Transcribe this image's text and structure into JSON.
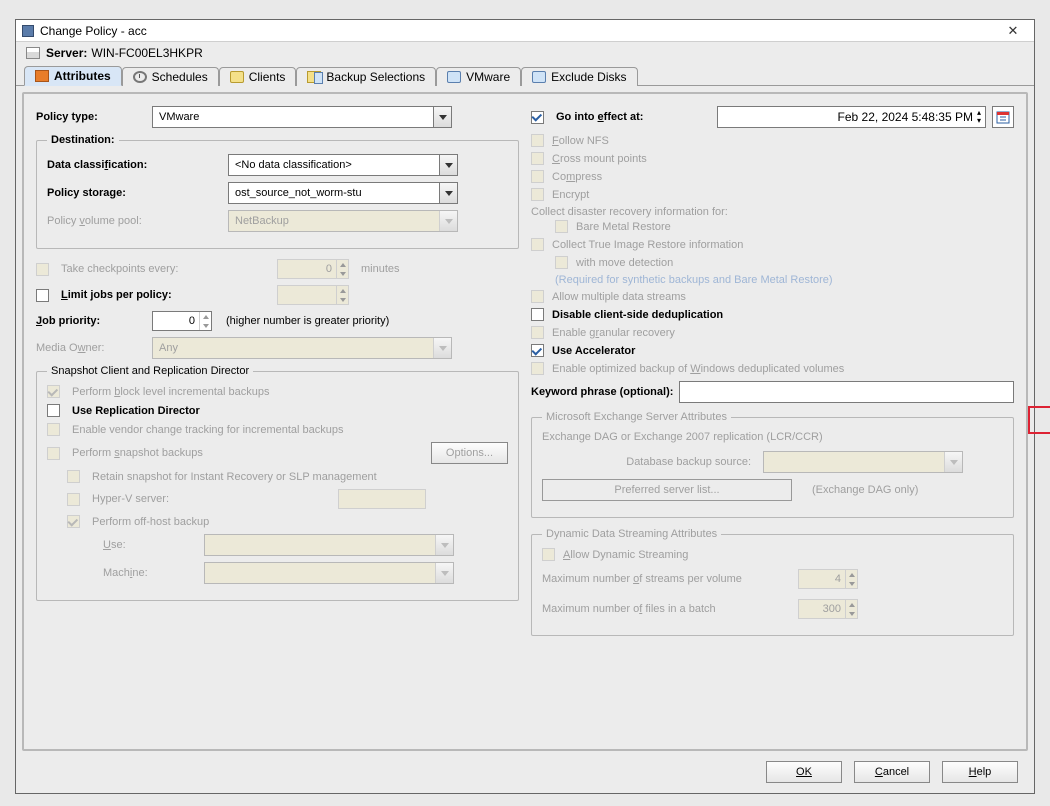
{
  "window": {
    "title": "Change Policy - acc"
  },
  "server": {
    "label": "Server:",
    "name": "WIN-FC00EL3HKPR"
  },
  "tabs": {
    "attributes": "Attributes",
    "schedules": "Schedules",
    "clients": "Clients",
    "backup_selections": "Backup Selections",
    "vmware": "VMware",
    "exclude_disks": "Exclude Disks"
  },
  "left": {
    "policy_type_label": "Policy type:",
    "policy_type_value": "VMware",
    "destination_legend": "Destination:",
    "data_classification_label": "Data classification:",
    "data_classification_value": "<No data classification>",
    "policy_storage_label": "Policy storage:",
    "policy_storage_value": "ost_source_not_worm-stu",
    "policy_volume_pool_label": "Policy volume pool:",
    "policy_volume_pool_value": "NetBackup",
    "take_checkpoints_label": "Take checkpoints every:",
    "take_checkpoints_value": "0",
    "take_checkpoints_unit": "minutes",
    "limit_jobs_label": "Limit jobs per policy:",
    "limit_jobs_value": "",
    "job_priority_label": "Job priority:",
    "job_priority_value": "0",
    "job_priority_hint": "(higher number is greater priority)",
    "media_owner_label": "Media Owner:",
    "media_owner_value": "Any",
    "snapshot_legend": "Snapshot Client and Replication Director",
    "block_level": "Perform block level incremental backups",
    "use_repl_director": "Use Replication Director",
    "vendor_change": "Enable vendor change tracking for incremental backups",
    "perform_snapshot": "Perform snapshot backups",
    "options_btn": "Options...",
    "retain_snapshot": "Retain snapshot for Instant Recovery or SLP management",
    "hyperv_server": "Hyper-V server:",
    "offhost": "Perform off-host backup",
    "use_label": "Use:",
    "machine_label": "Machine:"
  },
  "right": {
    "go_into_effect": "Go into effect at:",
    "effect_date": "Feb 22, 2024 5:48:35 PM",
    "follow_nfs": "Follow NFS",
    "cross_mount": "Cross mount points",
    "compress": "Compress",
    "encrypt": "Encrypt",
    "collect_dr": "Collect disaster recovery information for:",
    "bare_metal": "Bare Metal Restore",
    "collect_tir": "Collect True Image Restore information",
    "with_move": "with move detection",
    "required_note": "(Required for synthetic backups and Bare Metal Restore)",
    "allow_multiple": "Allow multiple data streams",
    "disable_dedup": "Disable client-side deduplication",
    "enable_granular": "Enable granular recovery",
    "use_accelerator": "Use Accelerator",
    "enable_optimized": "Enable optimized backup of Windows deduplicated volumes",
    "keyword_label": "Keyword phrase (optional):",
    "ex_legend": "Microsoft Exchange Server Attributes",
    "ex_dag_note": "Exchange DAG or Exchange 2007 replication (LCR/CCR)",
    "db_backup_source": "Database backup source:",
    "pref_server_list": "Preferred server list...",
    "ex_dag_only": "(Exchange DAG only)",
    "dyn_legend": "Dynamic Data Streaming Attributes",
    "allow_dyn": "Allow Dynamic Streaming",
    "max_streams": "Maximum number of streams per volume",
    "max_streams_val": "4",
    "max_files": "Maximum number of files in a batch",
    "max_files_val": "300"
  },
  "buttons": {
    "ok": "OK",
    "cancel": "Cancel",
    "help": "Help"
  }
}
